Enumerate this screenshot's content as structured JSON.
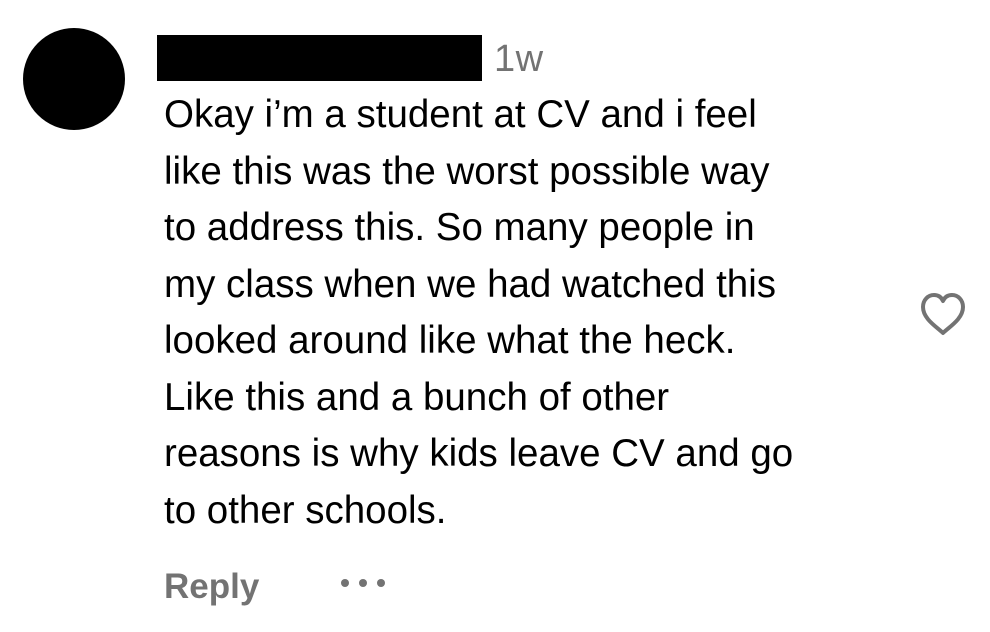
{
  "comment": {
    "timestamp": "1w",
    "text": "Okay i’m a student at CV and i feel\nlike this was the worst possible way\nto address this. So many people in\nmy class when we had watched this\nlooked around like what the heck.\nLike this and a bunch of other\nreasons is why kids leave CV and go\nto other schools.",
    "reply_label": "Reply",
    "colors": {
      "text": "#000000",
      "secondary": "#737373",
      "avatar": "#000000",
      "redaction": "#000000"
    }
  },
  "icons": {
    "like": "heart-outline-icon",
    "more": "more-options-icon"
  }
}
